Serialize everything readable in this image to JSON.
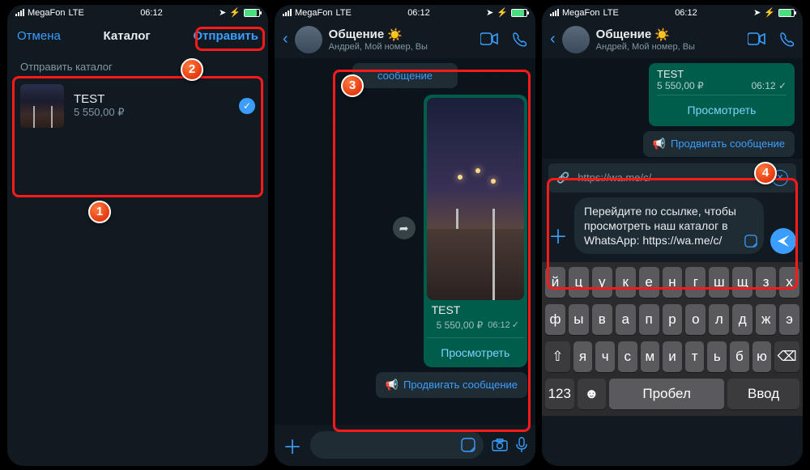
{
  "status": {
    "carrier": "MegaFon",
    "network": "LTE",
    "time": "06:12"
  },
  "screen1": {
    "cancel": "Отмена",
    "title": "Каталог",
    "send": "Отправить",
    "subtitle": "Отправить каталог",
    "item": {
      "name": "TEST",
      "price": "5 550,00 ₽"
    }
  },
  "chat": {
    "title": "Общение",
    "subtitle": "Андрей, Мой номер, Вы"
  },
  "screen2": {
    "promote_top": "сообщение",
    "bubble": {
      "name": "TEST",
      "price": "5 550,00 ₽",
      "time": "06:12",
      "action": "Просмотреть"
    },
    "promote_label": "Продвигать сообщение"
  },
  "screen3": {
    "mini": {
      "name": "TEST",
      "price": "5 550,00 ₽",
      "time": "06:12",
      "action": "Просмотреть"
    },
    "promote_label": "Продвигать сообщение",
    "link": "https://wa.me/c/",
    "compose_text": "Перейдите по ссылке, чтобы просмотреть наш каталог в WhatsApp: https://wa.me/c/"
  },
  "keyboard": {
    "row1": [
      "й",
      "ц",
      "у",
      "к",
      "е",
      "н",
      "г",
      "ш",
      "щ",
      "з",
      "х"
    ],
    "row2": [
      "ф",
      "ы",
      "в",
      "а",
      "п",
      "р",
      "о",
      "л",
      "д",
      "ж",
      "э"
    ],
    "row3_mid": [
      "я",
      "ч",
      "с",
      "м",
      "и",
      "т",
      "ь",
      "б",
      "ю"
    ],
    "num": "123",
    "space": "Пробел",
    "enter": "Ввод"
  },
  "badges": {
    "b1": "1",
    "b2": "2",
    "b3": "3",
    "b4": "4"
  }
}
